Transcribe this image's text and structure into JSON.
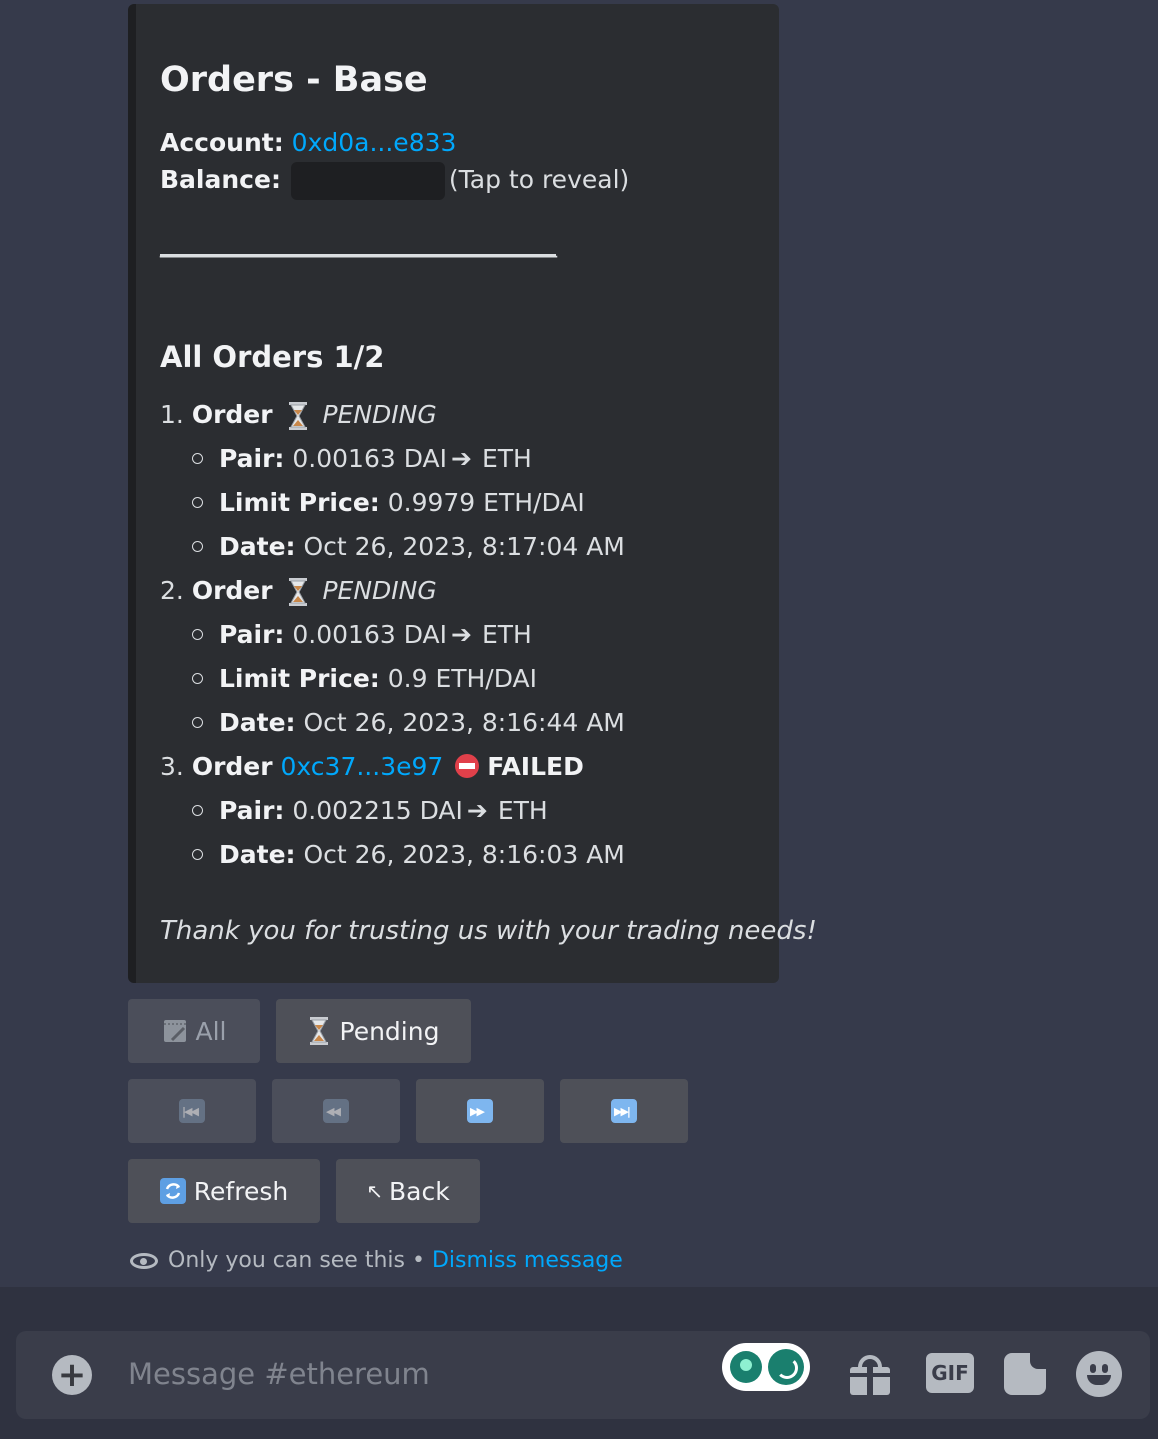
{
  "embed": {
    "title": "Orders - Base",
    "account_label": "Account:",
    "account_value": "0xd0a...e833",
    "balance_label": "Balance:",
    "balance_hint": "(Tap to reveal)",
    "divider": "____________________________________",
    "section_title": "All Orders 1/2",
    "orders": [
      {
        "num": "1.",
        "label": "Order",
        "status": "PENDING",
        "pair_label": "Pair:",
        "pair_from": "0.00163 DAI",
        "pair_to": "ETH",
        "limit_label": "Limit Price:",
        "limit_value": "0.9979 ETH/DAI",
        "date_label": "Date:",
        "date_value": "Oct 26, 2023, 8:17:04 AM"
      },
      {
        "num": "2.",
        "label": "Order",
        "status": "PENDING",
        "pair_label": "Pair:",
        "pair_from": "0.00163 DAI",
        "pair_to": "ETH",
        "limit_label": "Limit Price:",
        "limit_value": "0.9 ETH/DAI",
        "date_label": "Date:",
        "date_value": "Oct 26, 2023, 8:16:44 AM"
      },
      {
        "num": "3.",
        "label": "Order",
        "tx": "0xc37...3e97",
        "status": "FAILED",
        "pair_label": "Pair:",
        "pair_from": "0.002215 DAI",
        "pair_to": "ETH",
        "date_label": "Date:",
        "date_value": "Oct 26, 2023, 8:16:03 AM"
      }
    ],
    "arrow": "➔",
    "footer": "Thank you for trusting us with your trading needs!"
  },
  "buttons": {
    "all": "All",
    "pending": "Pending",
    "refresh": "Refresh",
    "back": "Back",
    "back_glyph": "↖"
  },
  "notice": {
    "text": "Only you can see this •",
    "dismiss": "Dismiss message"
  },
  "composer": {
    "placeholder": "Message #ethereum",
    "gif": "GIF"
  },
  "icons": {
    "hourglass": "hourglass-icon",
    "failed": "no-entry-icon",
    "first": "first-page-icon",
    "prev": "previous-page-icon",
    "next": "next-page-icon",
    "last": "last-page-icon",
    "refresh": "refresh-icon",
    "memo": "memo-icon"
  },
  "colors": {
    "link": "#00a8fc",
    "button": "#4e5058",
    "embed_bg": "#2b2d31",
    "failed": "#e0404a"
  }
}
